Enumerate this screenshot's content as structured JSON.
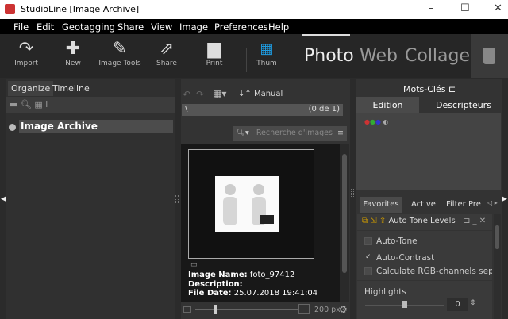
{
  "window": {
    "title": "StudioLine [Image Archive]",
    "minimize": "–",
    "maximize": "☐",
    "close": "✕"
  },
  "menu": [
    "File",
    "Edit",
    "Geotagging",
    "Share",
    "View",
    "Image",
    "Preferences",
    "Help"
  ],
  "toolbar": {
    "buttons": [
      {
        "label": "Import",
        "icon": "import-icon"
      },
      {
        "label": "New",
        "icon": "plus-icon"
      },
      {
        "label": "Image Tools",
        "icon": "dropper-icon"
      },
      {
        "label": "Share",
        "icon": "share-icon"
      },
      {
        "label": "Print",
        "icon": "printer-icon"
      },
      {
        "label": "Thum",
        "icon": "thumbnail-grid-icon"
      }
    ],
    "modes": [
      "Photo",
      "Web",
      "Collage"
    ],
    "active_mode": "Photo",
    "accent": "#1e9be0"
  },
  "left": {
    "tabs": [
      "Organize",
      "Timeline"
    ],
    "active_tab": "Organize",
    "tree": [
      {
        "label": "Image Archive"
      }
    ]
  },
  "middle": {
    "sort_label": "Manual",
    "path": "\\",
    "count": "(0 de 1)",
    "search_placeholder": "Recherche d'images",
    "image": {
      "name_label": "Image Name:",
      "name": "foto_97412",
      "description_label": "Description:",
      "description": "",
      "date_label": "File Date:",
      "date": "25.07.2018 19:41:04"
    },
    "size_label": "200 px"
  },
  "right": {
    "title": "Mots-Clés",
    "tabs": [
      "Edition",
      "Descripteurs"
    ],
    "active_tab": "Edition",
    "filter_tabs": [
      "Favorites",
      "Active",
      "Filter Pre"
    ],
    "active_filter_tab": "Favorites",
    "panel_title": "Auto Tone Levels",
    "options": [
      {
        "label": "Auto-Tone",
        "checked": false
      },
      {
        "label": "Auto-Contrast",
        "checked": true
      },
      {
        "label": "Calculate RGB-channels separate",
        "checked": false
      }
    ],
    "highlights_label": "Highlights",
    "highlights_value": "0"
  }
}
